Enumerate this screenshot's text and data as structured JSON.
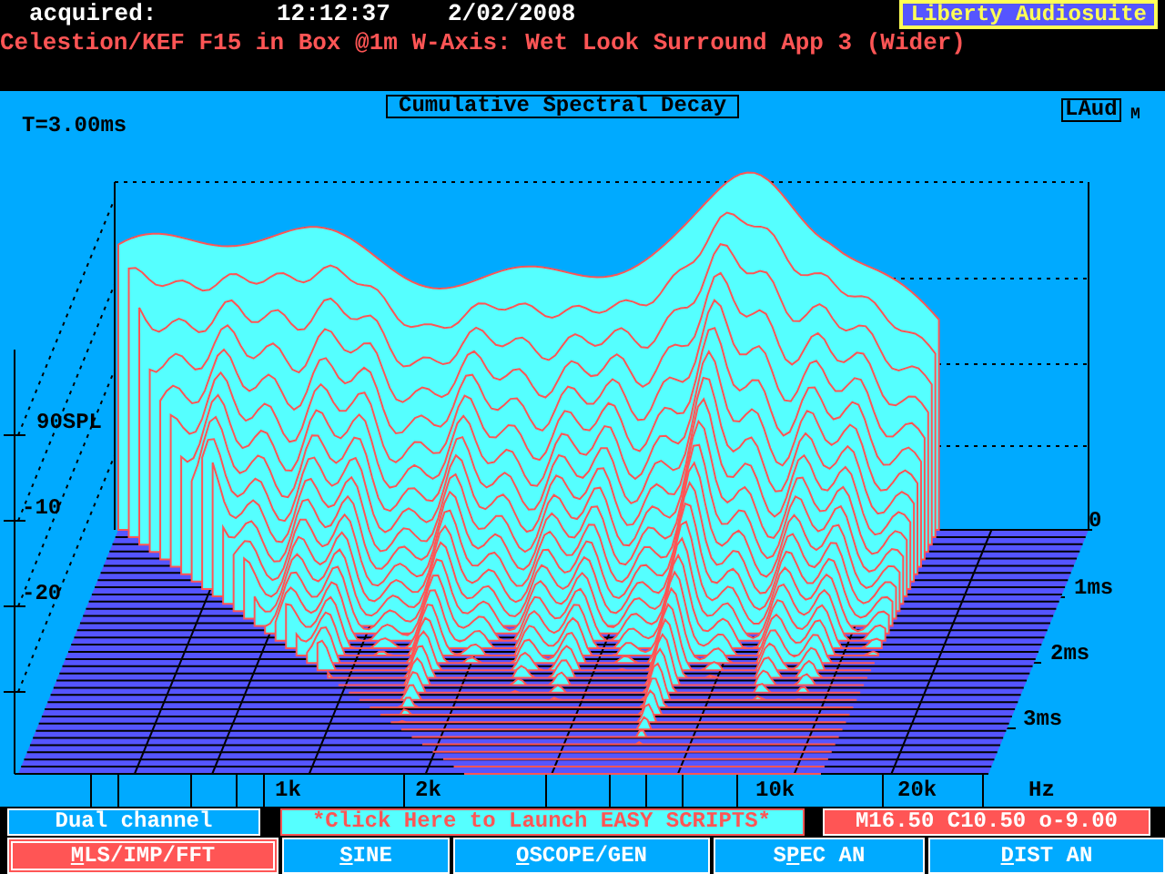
{
  "header": {
    "acquired_label": "acquired:",
    "time": "12:12:37",
    "date": "2/02/2008",
    "brand": "Liberty Audiosuite",
    "title": "Celestion/KEF F15 in Box @1m W-Axis: Wet Look Surround App 3 (Wider)"
  },
  "plot": {
    "title": "Cumulative Spectral Decay",
    "logo": "LAud",
    "logo_sub": "M",
    "time_readout": "T=3.00ms",
    "y_labels": [
      "90SPL",
      "-10",
      "-20"
    ],
    "x_labels": [
      "1k",
      "2k",
      "10k",
      "20k",
      "Hz"
    ],
    "time_labels": [
      "0",
      "1ms",
      "2ms",
      "3ms"
    ]
  },
  "status": {
    "channel": "Dual channel",
    "scripts": "*Click Here to Launch EASY SCRIPTS*",
    "readout": "M16.50 C10.50 o-9.00"
  },
  "tabs": [
    {
      "key": "M",
      "post": "LS/IMP/FFT",
      "selected": true
    },
    {
      "key": "S",
      "post": "INE",
      "selected": false
    },
    {
      "key": "O",
      "post": "SCOPE/GEN",
      "selected": false
    },
    {
      "pre": "S",
      "key": "P",
      "post": "EC AN",
      "selected": false
    },
    {
      "key": "D",
      "post": "IST AN",
      "selected": false
    }
  ]
}
